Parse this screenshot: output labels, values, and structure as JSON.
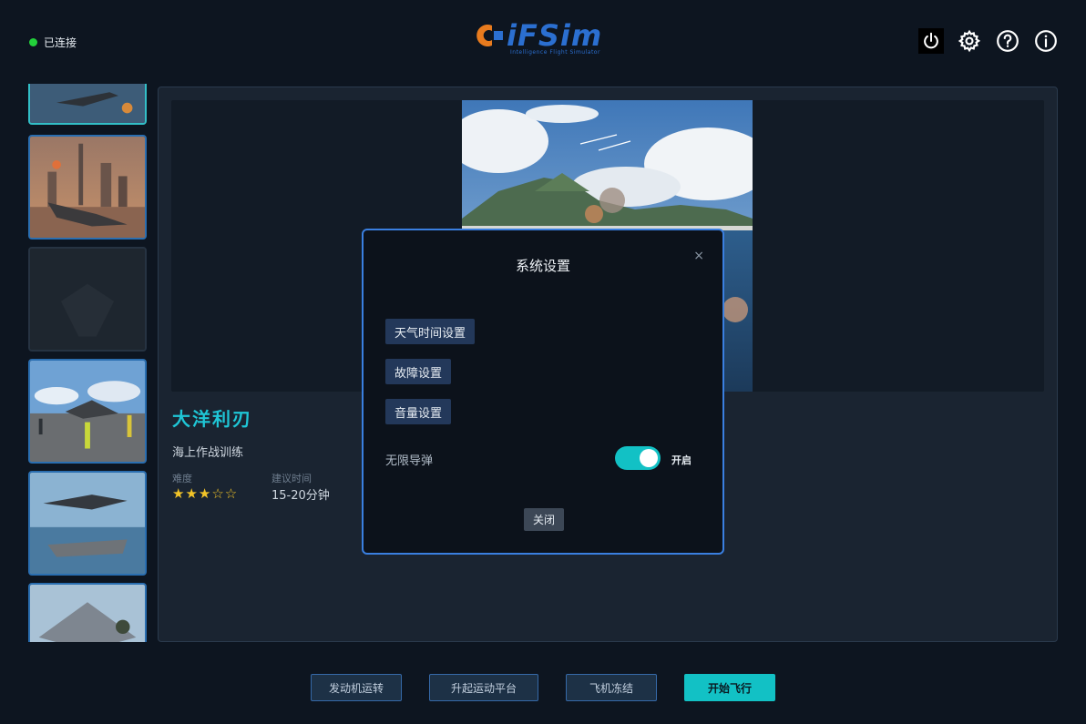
{
  "header": {
    "connection_status": "已连接",
    "logo_text": "iFSim",
    "logo_subtitle": "Intelligence Flight Simulator"
  },
  "header_icons": [
    "power-icon",
    "gear-icon",
    "help-icon",
    "info-icon"
  ],
  "main": {
    "mission_title": "大洋利刃",
    "mission_subtitle": "海上作战训练",
    "difficulty_label": "难度",
    "difficulty_stars": "★★★☆☆",
    "difficulty_rating": 3,
    "time_label": "建议时间",
    "time_value": "15-20分钟"
  },
  "bottom_buttons": {
    "engine": "发动机运转",
    "platform": "升起运动平台",
    "freeze": "飞机冻结",
    "start": "开始飞行"
  },
  "modal": {
    "title": "系统设置",
    "close_x": "×",
    "weather_time": "天气时间设置",
    "fault": "故障设置",
    "volume": "音量设置",
    "unlimited_missiles_label": "无限导弹",
    "unlimited_missiles_on": true,
    "toggle_state": "开启",
    "close_button": "关闭"
  },
  "colors": {
    "accent_cyan": "#12c1c5",
    "modal_border": "#3a7fe0",
    "status_green": "#22d13a",
    "star_gold": "#f2c428"
  }
}
